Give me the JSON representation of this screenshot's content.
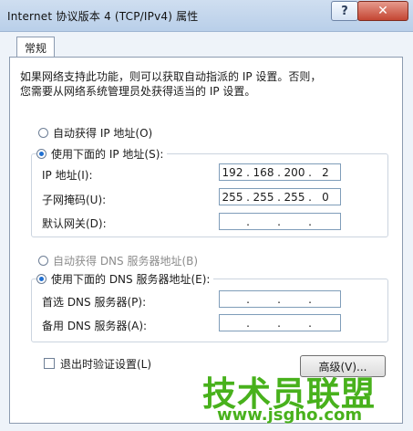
{
  "window": {
    "title": "Internet 协议版本 4 (TCP/IPv4) 属性",
    "help_label": "?",
    "close_label": "✕"
  },
  "tabs": [
    {
      "label": "常规"
    }
  ],
  "description": {
    "line1": "如果网络支持此功能，则可以获取自动指派的 IP 设置。否则，",
    "line2": "您需要从网络系统管理员处获得适当的 IP 设置。"
  },
  "ip": {
    "auto_label": "自动获得 IP 地址(O)",
    "manual_label": "使用下面的 IP 地址(S):",
    "selected": "manual",
    "fields": [
      {
        "label": "IP 地址(I):",
        "octets": [
          "192",
          "168",
          "200",
          "2"
        ]
      },
      {
        "label": "子网掩码(U):",
        "octets": [
          "255",
          "255",
          "255",
          "0"
        ]
      },
      {
        "label": "默认网关(D):",
        "octets": [
          "",
          "",
          "",
          ""
        ]
      }
    ]
  },
  "dns": {
    "auto_label": "自动获得 DNS 服务器地址(B)",
    "manual_label": "使用下面的 DNS 服务器地址(E):",
    "selected": "manual",
    "fields": [
      {
        "label": "首选 DNS 服务器(P):",
        "octets": [
          "",
          "",
          "",
          ""
        ]
      },
      {
        "label": "备用 DNS 服务器(A):",
        "octets": [
          "",
          "",
          "",
          ""
        ]
      }
    ]
  },
  "validate_checkbox": {
    "label": "退出时验证设置(L)",
    "checked": false
  },
  "advanced_button": {
    "label": "高级(V)..."
  },
  "watermark": {
    "line1": "技术员联盟",
    "line2": "www.jsgho.com"
  },
  "colors": {
    "watermark": "#48b11c",
    "radio_dot": "#1f6fd1",
    "close_button": "#c44633"
  }
}
